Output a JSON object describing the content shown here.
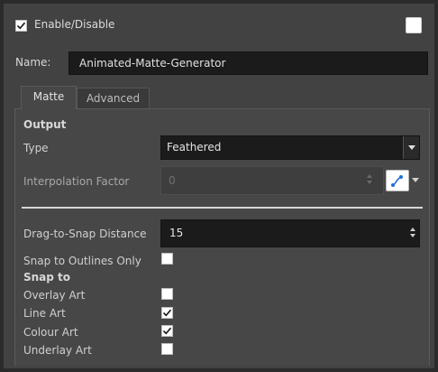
{
  "header": {
    "enable_label": "Enable/Disable",
    "enable_checked": true
  },
  "name": {
    "label": "Name:",
    "value": "Animated-Matte-Generator"
  },
  "tabs": [
    {
      "label": "Matte",
      "active": true
    },
    {
      "label": "Advanced",
      "active": false
    }
  ],
  "output": {
    "title": "Output",
    "type_label": "Type",
    "type_value": "Feathered",
    "interp_label": "Interpolation Factor",
    "interp_value": "0"
  },
  "snap": {
    "distance_label": "Drag-to-Snap Distance",
    "distance_value": "15",
    "outlines_only_label": "Snap to Outlines Only",
    "outlines_only_checked": false,
    "title": "Snap to",
    "items": [
      {
        "label": "Overlay Art",
        "checked": false
      },
      {
        "label": "Line Art",
        "checked": true
      },
      {
        "label": "Colour Art",
        "checked": true
      },
      {
        "label": "Underlay Art",
        "checked": false
      }
    ]
  },
  "colors": {
    "panel_bg": "#424242",
    "field_bg": "#1b1b1b",
    "text": "#d8d8d8",
    "function_icon_accent": "#1e6fd9"
  },
  "icons": {
    "function": "function-curve-icon",
    "check": "checkmark-icon"
  }
}
